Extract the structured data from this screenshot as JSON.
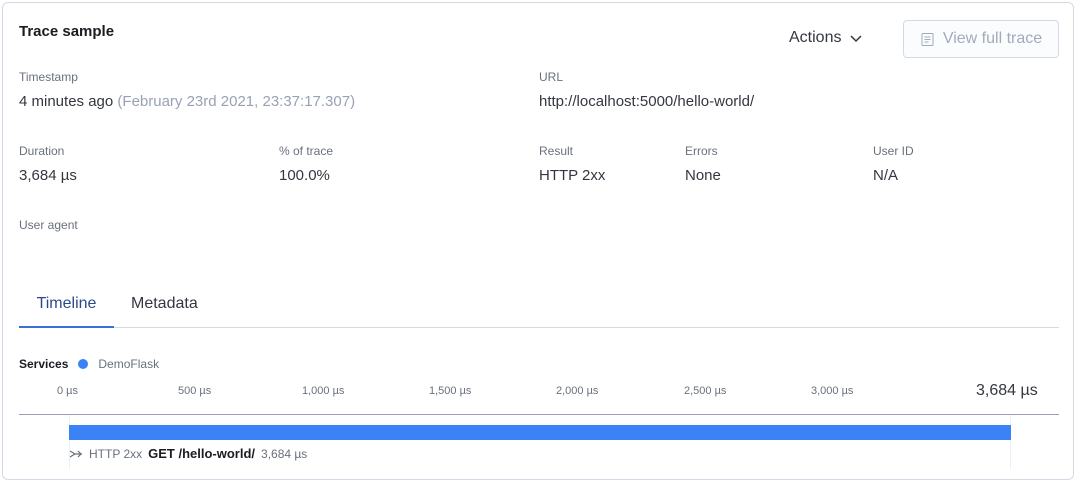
{
  "panel": {
    "title": "Trace sample",
    "actions_label": "Actions",
    "view_full_trace_label": "View full trace"
  },
  "fields": {
    "timestamp": {
      "label": "Timestamp",
      "value": "4 minutes ago",
      "detail": "(February 23rd 2021, 23:37:17.307)"
    },
    "url": {
      "label": "URL",
      "value": "http://localhost:5000/hello-world/"
    },
    "duration": {
      "label": "Duration",
      "value": "3,684 µs"
    },
    "percent": {
      "label": "% of trace",
      "value": "100.0%"
    },
    "result": {
      "label": "Result",
      "value": "HTTP 2xx"
    },
    "errors": {
      "label": "Errors",
      "value": "None"
    },
    "user_id": {
      "label": "User ID",
      "value": "N/A"
    },
    "user_agent": {
      "label": "User agent",
      "value": ""
    }
  },
  "tabs": [
    {
      "label": "Timeline",
      "active": true
    },
    {
      "label": "Metadata",
      "active": false
    }
  ],
  "services": {
    "label": "Services",
    "items": [
      {
        "name": "DemoFlask",
        "color": "#3b82f6"
      }
    ]
  },
  "timeline": {
    "ticks": [
      "0 µs",
      "500 µs",
      "1,000 µs",
      "1,500 µs",
      "2,000 µs",
      "2,500 µs",
      "3,000 µs"
    ],
    "end_label": "3,684 µs",
    "span": {
      "result": "HTTP 2xx",
      "name": "GET /hello-world/",
      "duration": "3,684 µs",
      "fraction": 1.0,
      "color": "#3b82f6"
    }
  }
}
